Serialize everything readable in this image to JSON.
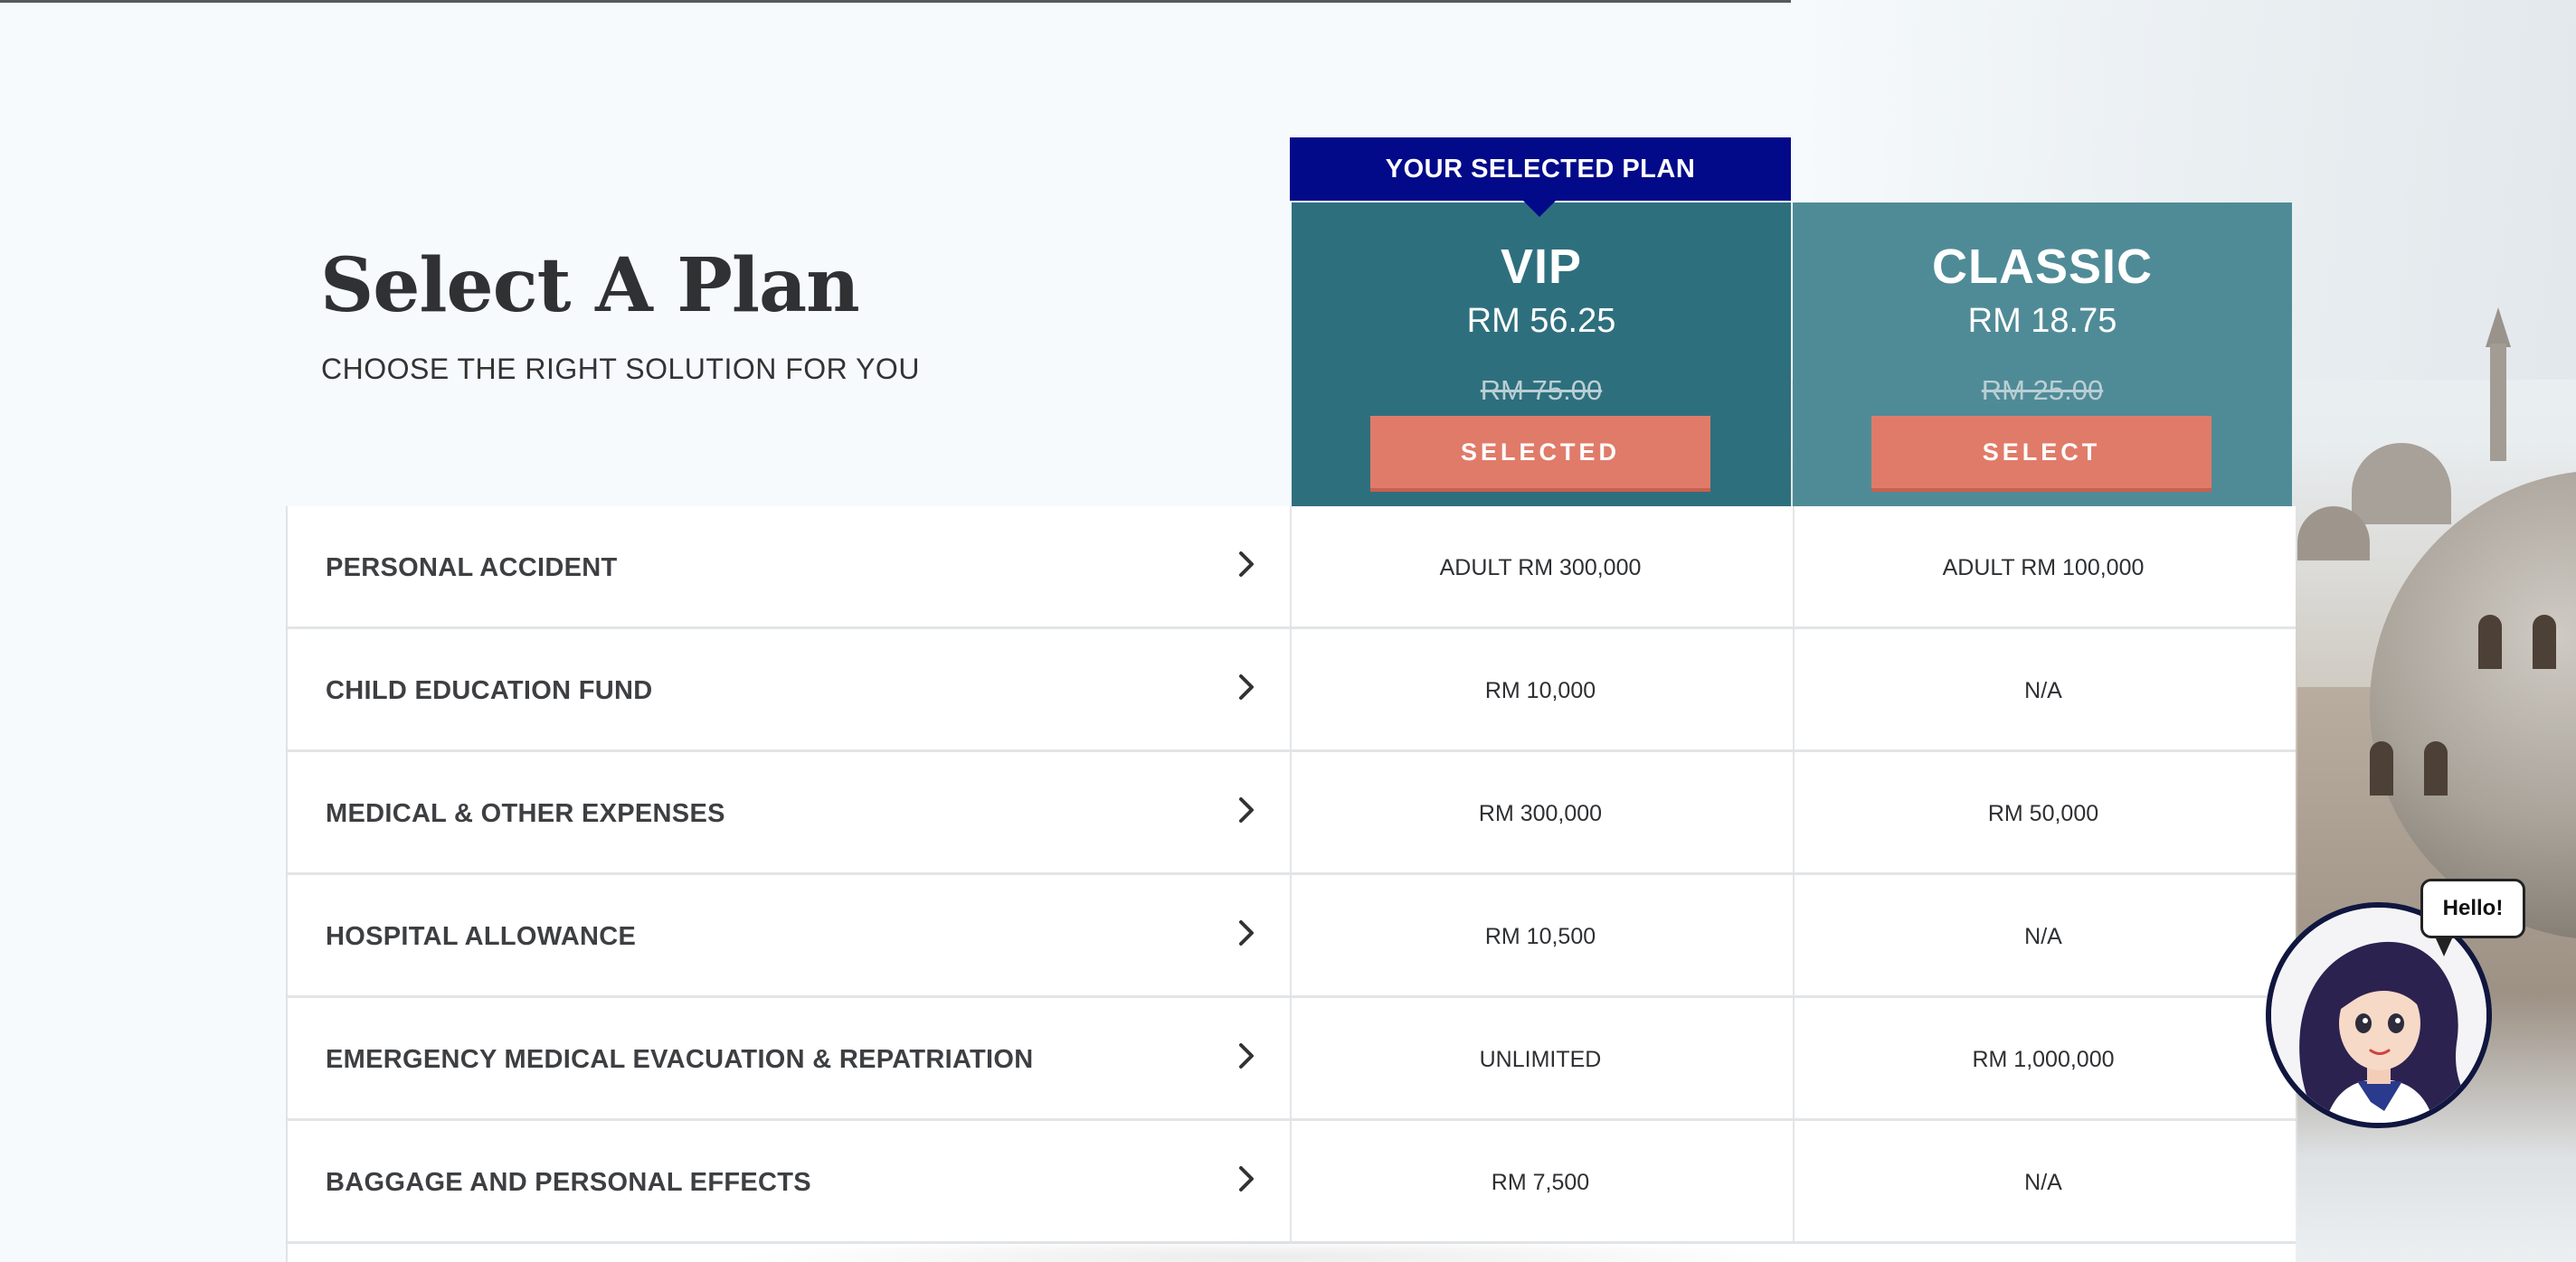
{
  "header": {
    "title": "Select A Plan",
    "subtitle": "CHOOSE THE RIGHT SOLUTION FOR YOU",
    "selected_ribbon": "YOUR SELECTED PLAN"
  },
  "plans": [
    {
      "name": "VIP",
      "price": "RM 56.25",
      "original_price": "RM 75.00",
      "button_label": "SELECTED",
      "color": "#2e6f7e"
    },
    {
      "name": "CLASSIC",
      "price": "RM 18.75",
      "original_price": "RM 25.00",
      "button_label": "SELECT",
      "color": "#4f8b97"
    }
  ],
  "benefits": [
    {
      "label": "PERSONAL ACCIDENT",
      "vip": "ADULT RM 300,000",
      "classic": "ADULT RM 100,000"
    },
    {
      "label": "CHILD EDUCATION FUND",
      "vip": "RM 10,000",
      "classic": "N/A"
    },
    {
      "label": "MEDICAL & OTHER EXPENSES",
      "vip": "RM 300,000",
      "classic": "RM 50,000"
    },
    {
      "label": "HOSPITAL ALLOWANCE",
      "vip": "RM 10,500",
      "classic": "N/A"
    },
    {
      "label": "EMERGENCY MEDICAL EVACUATION & REPATRIATION",
      "vip": "UNLIMITED",
      "classic": "RM 1,000,000"
    },
    {
      "label": "BAGGAGE AND PERSONAL EFFECTS",
      "vip": "RM 7,500",
      "classic": "N/A"
    }
  ],
  "assistant": {
    "greeting": "Hello!"
  },
  "icons": {
    "row_expand": "chevron-right-icon"
  },
  "colors": {
    "ribbon": "#020a8a",
    "button": "#e07b69"
  }
}
